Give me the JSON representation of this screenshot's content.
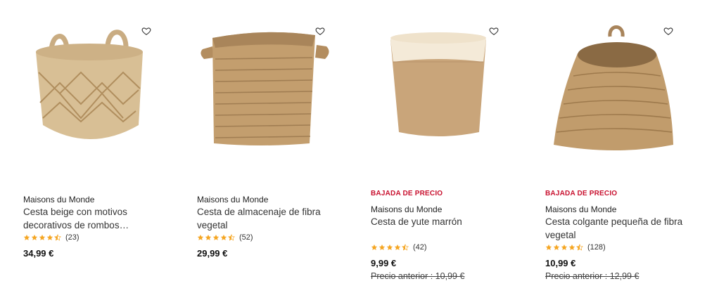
{
  "products": [
    {
      "id": "p1",
      "brand": "Maisons du Monde",
      "name": "Cesta beige con motivos decorativos de rombos…",
      "rating_value": 4.5,
      "rating_count": "(23)",
      "price": "34,99 €",
      "badge": "",
      "old_price": ""
    },
    {
      "id": "p2",
      "brand": "Maisons du Monde",
      "name": "Cesta de almacenaje de fibra vegetal",
      "rating_value": 4.5,
      "rating_count": "(52)",
      "price": "29,99 €",
      "badge": "",
      "old_price": ""
    },
    {
      "id": "p3",
      "brand": "Maisons du Monde",
      "name": "Cesta de yute marrón",
      "rating_value": 4.5,
      "rating_count": "(42)",
      "price": "9,99 €",
      "badge": "BAJADA DE PRECIO",
      "old_price": "Precio anterior : 10,99 €"
    },
    {
      "id": "p4",
      "brand": "Maisons du Monde",
      "name": "Cesta colgante pequeña de fibra vegetal",
      "rating_value": 4.5,
      "rating_count": "(128)",
      "price": "10,99 €",
      "badge": "BAJADA DE PRECIO",
      "old_price": "Precio anterior : 12,99 €"
    }
  ],
  "icons": {
    "favorite": "heart-outline-icon",
    "star_full": "star-icon",
    "star_half": "star-half-icon"
  },
  "colors": {
    "badge": "#c8102e",
    "star": "#f5a623"
  }
}
